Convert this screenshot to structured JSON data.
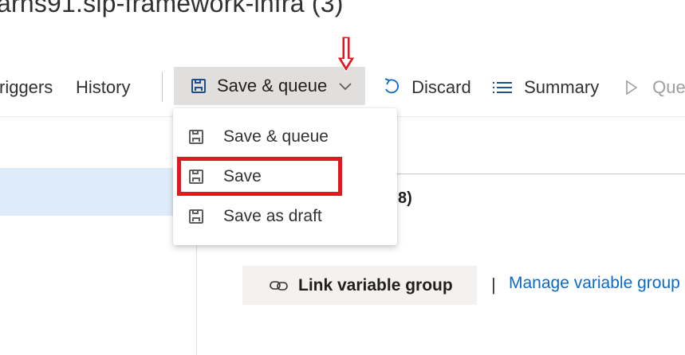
{
  "header": {
    "title": "arns91.sip-framework-infra (3)"
  },
  "toolbar": {
    "triggers_label": "riggers",
    "history_label": "History",
    "save_queue_label": "Save & queue",
    "discard_label": "Discard",
    "summary_label": "Summary",
    "queue_label": "Queu"
  },
  "save_menu": {
    "items": [
      {
        "label": "Save & queue",
        "icon": "floppy-disk-icon"
      },
      {
        "label": "Save",
        "icon": "floppy-disk-icon",
        "highlighted": true
      },
      {
        "label": "Save as draft",
        "icon": "floppy-disk-icon"
      }
    ]
  },
  "content": {
    "group_count_fragment": "8)",
    "link_variable_group_label": "Link variable group",
    "separator": "|",
    "manage_variable_groups_label": "Manage variable group"
  },
  "colors": {
    "annotation_red": "#e8141f",
    "link_blue": "#0b6ac6",
    "selection_blue": "#deecf9",
    "button_gray": "#e1dfdd"
  }
}
